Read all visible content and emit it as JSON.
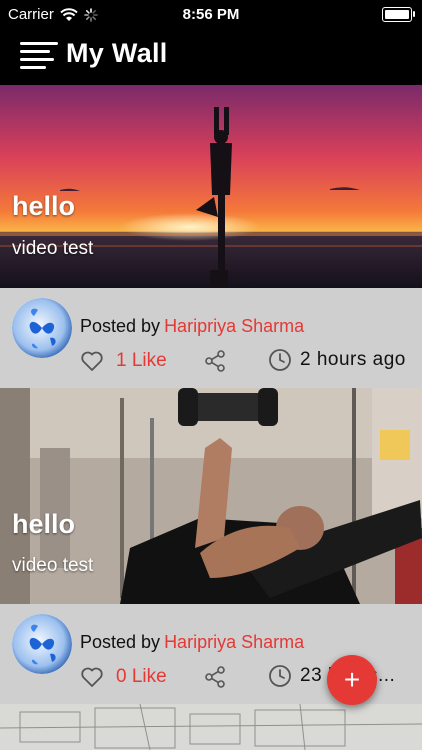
{
  "status_bar": {
    "carrier": "Carrier",
    "time": "8:56 PM"
  },
  "header": {
    "title": "My Wall"
  },
  "posts": [
    {
      "title": "hello",
      "subtitle": "video test",
      "posted_by_label": "Posted by",
      "author": "Haripriya Sharma",
      "likes": "1 Like",
      "time": "2 hours ago"
    },
    {
      "title": "hello",
      "subtitle": "video test",
      "posted_by_label": "Posted by",
      "author": "Haripriya Sharma",
      "likes": "0 Like",
      "time": "23 hours..."
    }
  ],
  "colors": {
    "accent": "#e53935",
    "meta_bg": "#cfcfcf",
    "bar_bg": "#000000"
  },
  "icons": {
    "menu": "hamburger-icon",
    "like": "heart-icon",
    "share": "share-icon",
    "time": "clock-icon",
    "add": "plus-icon"
  }
}
